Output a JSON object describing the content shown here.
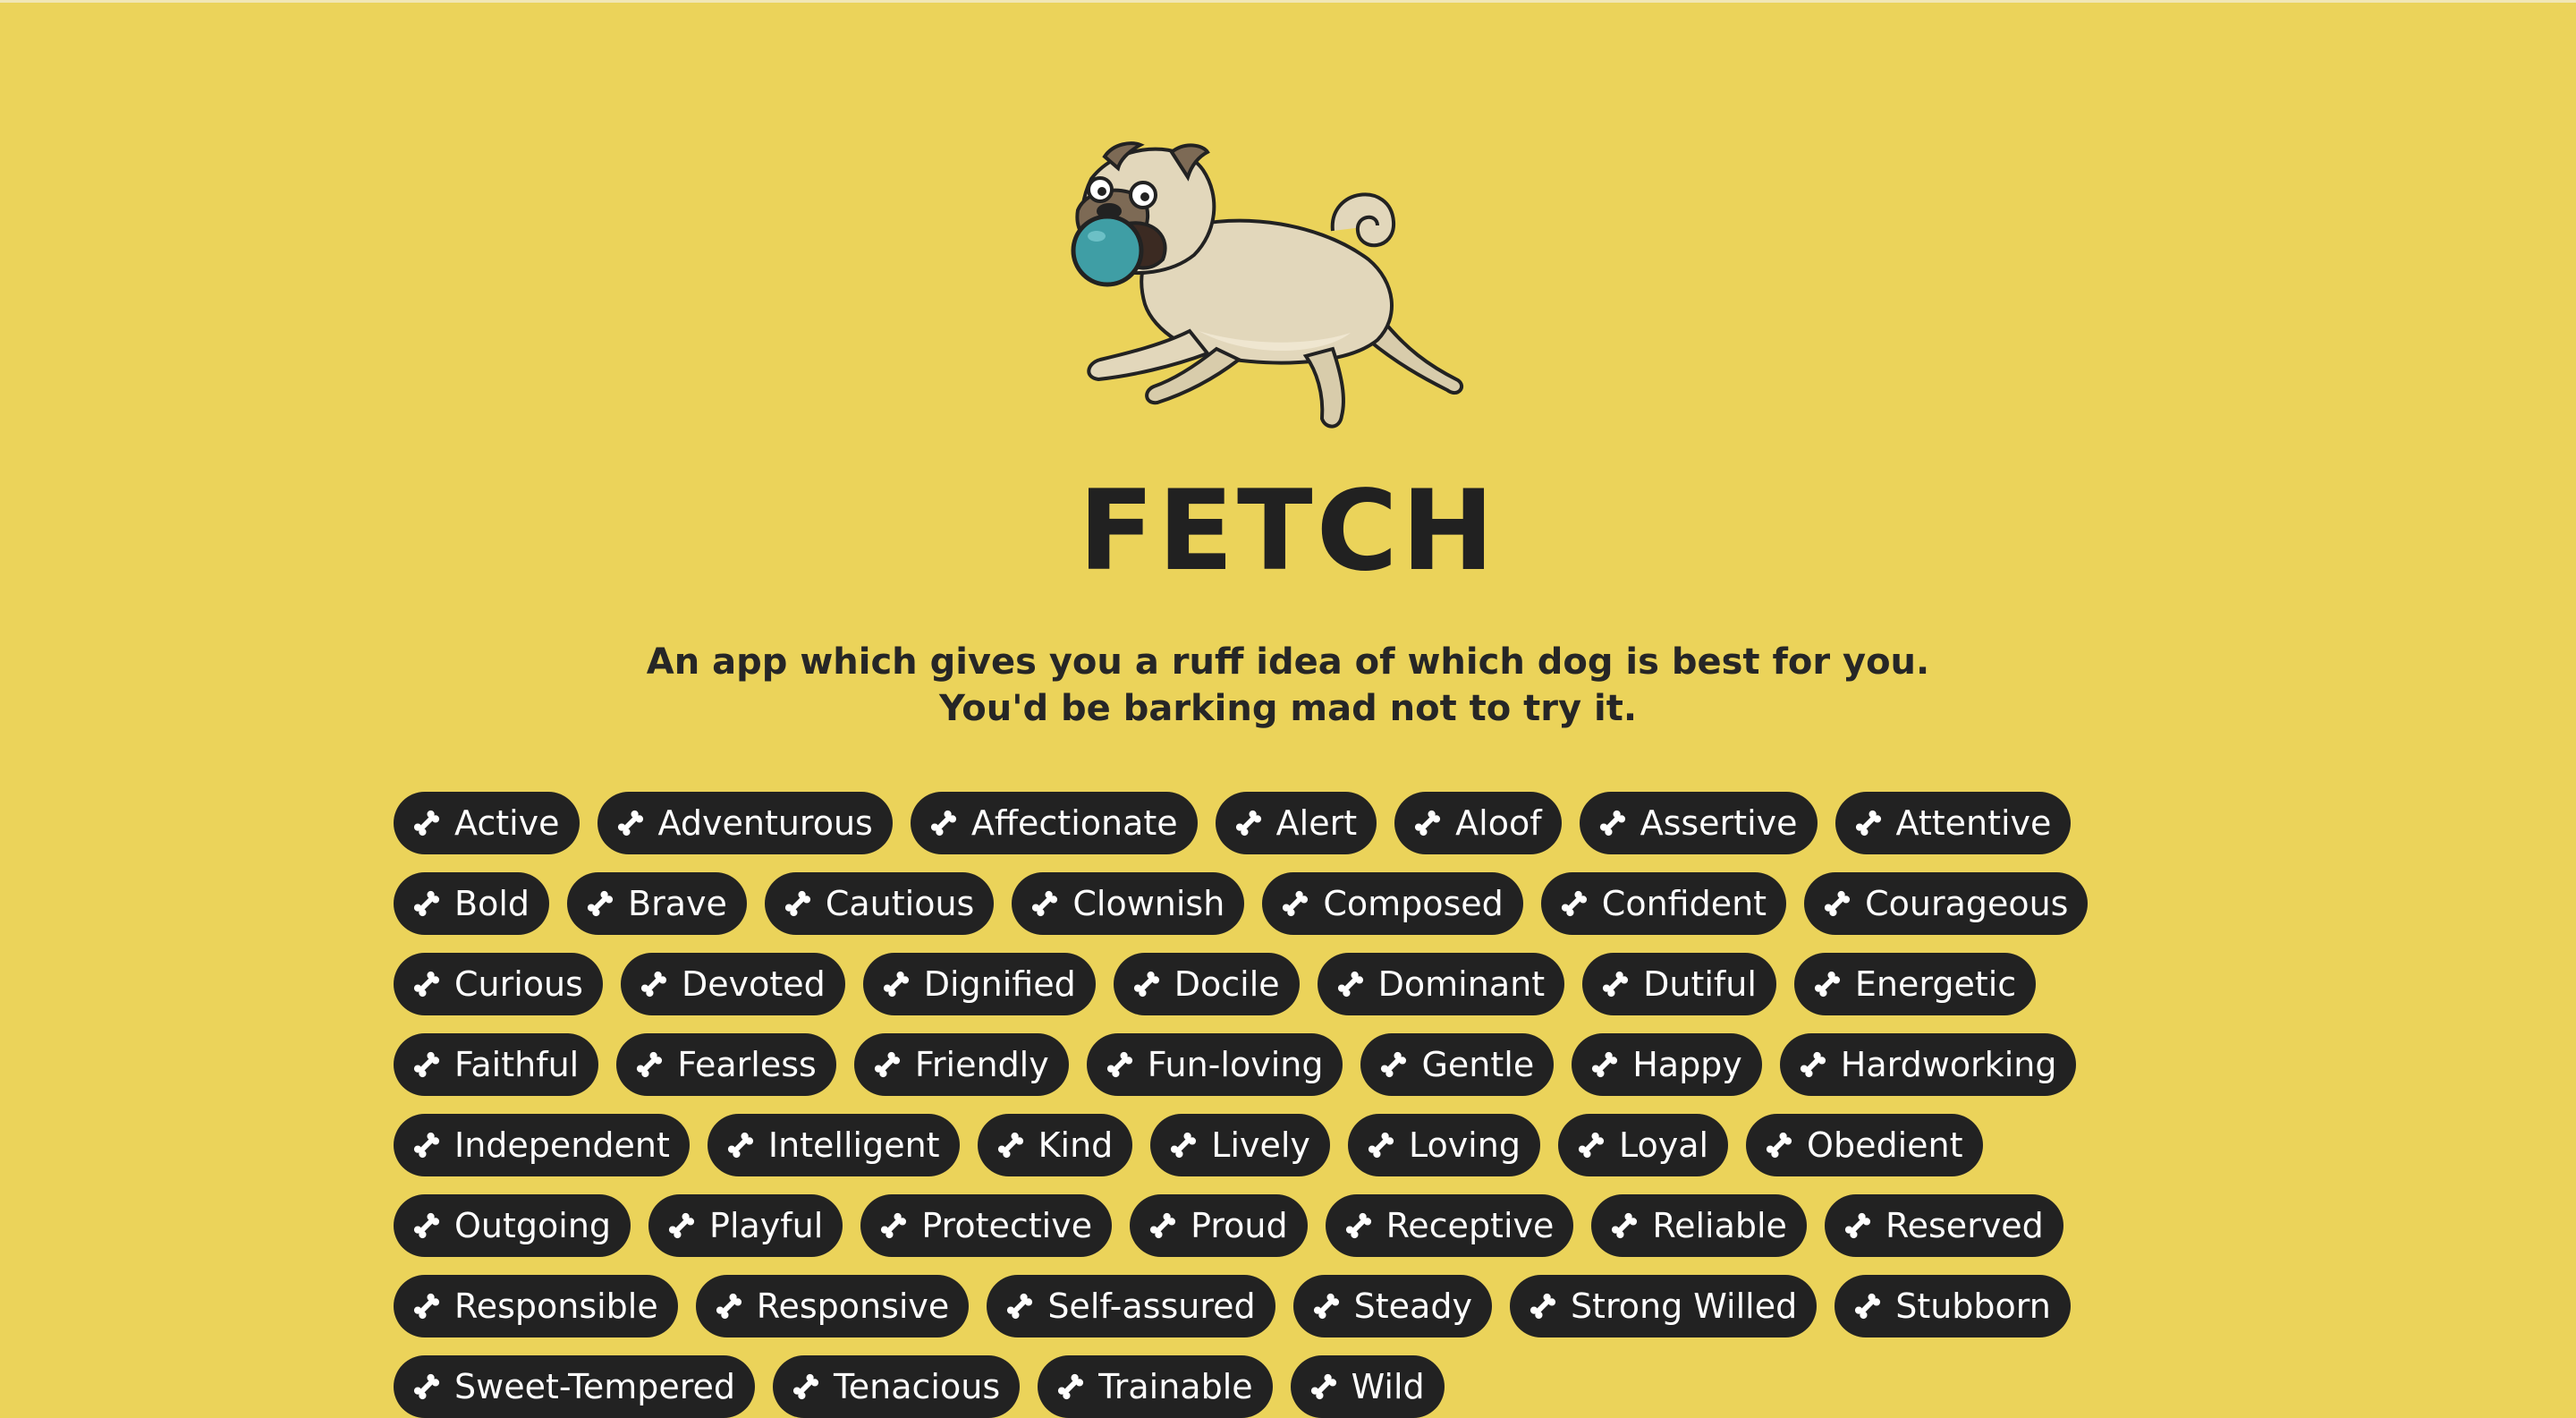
{
  "app": {
    "title": "FETCH",
    "tagline_line1": "An app which gives you a ruff idea of which dog is best for you.",
    "tagline_line2": "You'd be barking mad not to try it."
  },
  "colors": {
    "background": "#ebd35a",
    "tag_background": "#222222",
    "tag_text": "#ffffff",
    "title_text": "#212121",
    "ball": "#3f9ea5",
    "pug_body": "#e2d7bb"
  },
  "mascot": {
    "icon": "pug-with-ball-icon"
  },
  "tag_icon": "bone-icon",
  "traits": [
    "Active",
    "Adventurous",
    "Affectionate",
    "Alert",
    "Aloof",
    "Assertive",
    "Attentive",
    "Bold",
    "Brave",
    "Cautious",
    "Clownish",
    "Composed",
    "Confident",
    "Courageous",
    "Curious",
    "Devoted",
    "Dignified",
    "Docile",
    "Dominant",
    "Dutiful",
    "Energetic",
    "Faithful",
    "Fearless",
    "Friendly",
    "Fun-loving",
    "Gentle",
    "Happy",
    "Hardworking",
    "Independent",
    "Intelligent",
    "Kind",
    "Lively",
    "Loving",
    "Loyal",
    "Obedient",
    "Outgoing",
    "Playful",
    "Protective",
    "Proud",
    "Receptive",
    "Reliable",
    "Reserved",
    "Responsible",
    "Responsive",
    "Self-assured",
    "Steady",
    "Strong Willed",
    "Stubborn",
    "Sweet-Tempered",
    "Tenacious",
    "Trainable",
    "Wild"
  ]
}
